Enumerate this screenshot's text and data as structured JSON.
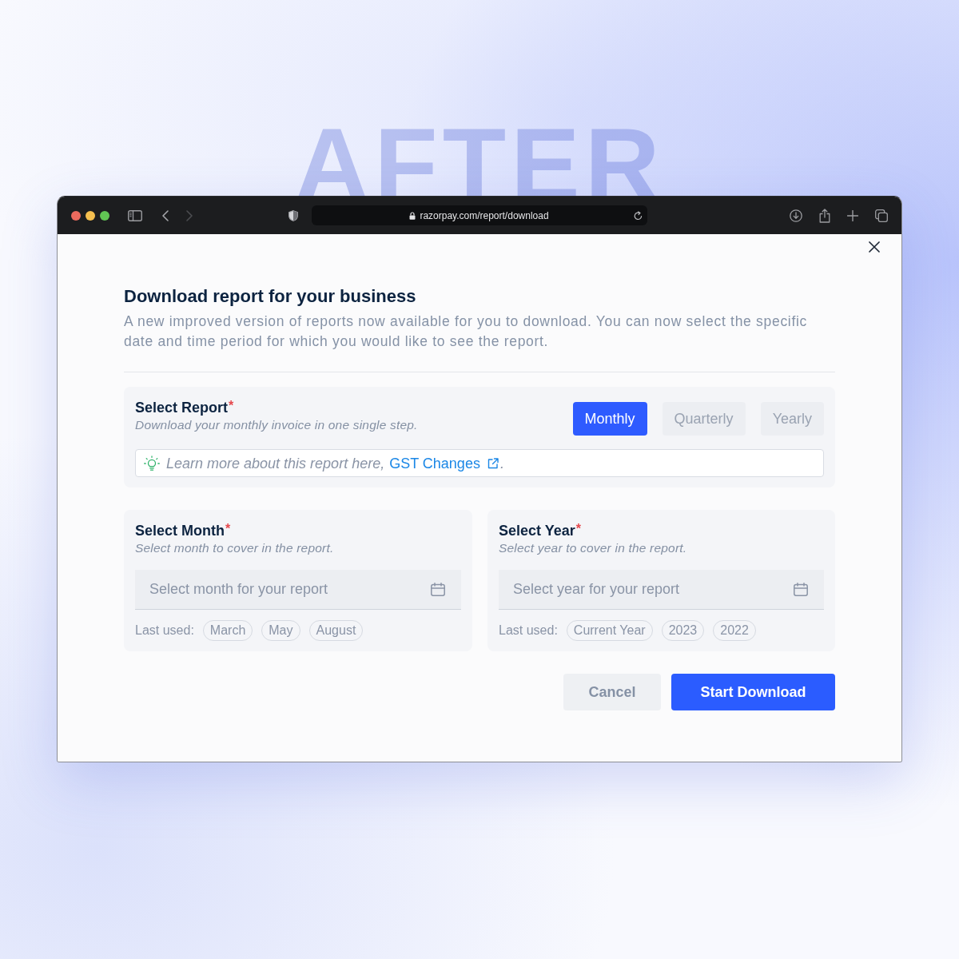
{
  "backdrop": {
    "heading": "AFTER"
  },
  "browser": {
    "nav": [
      {
        "kind": "back",
        "disabled": false
      },
      {
        "kind": "forward",
        "disabled": true
      }
    ],
    "url": "razorpay.com/report/download"
  },
  "dialog": {
    "title": "Download report for your business",
    "description": "A new improved version of reports now available for you to download. You can now select the specific date and time period for which you would like to see the report."
  },
  "report": {
    "title": "Select Report",
    "required_mark": "*",
    "subtitle": "Download your monthly invoice in one single step.",
    "options": [
      {
        "label": "Monthly",
        "selected": true
      },
      {
        "label": "Quarterly",
        "selected": false
      },
      {
        "label": "Yearly",
        "selected": false
      }
    ],
    "info": {
      "text": "Learn more about this report here,",
      "link": "GST Changes",
      "after": "."
    }
  },
  "pickers": [
    {
      "title": "Select Month",
      "required_mark": "*",
      "subtitle": "Select month to cover in the report.",
      "placeholder": "Select month for your report",
      "recent_label": "Last used:",
      "recent": [
        "March",
        "May",
        "August"
      ]
    },
    {
      "title": "Select Year",
      "required_mark": "*",
      "subtitle": "Select year to cover in the report.",
      "placeholder": "Select year for your report",
      "recent_label": "Last used:",
      "recent": [
        "Current Year",
        "2023",
        "2022"
      ]
    }
  ],
  "actions": [
    {
      "label": "Cancel",
      "kind": "cancel"
    },
    {
      "label": "Start Download",
      "kind": "confirm"
    }
  ]
}
